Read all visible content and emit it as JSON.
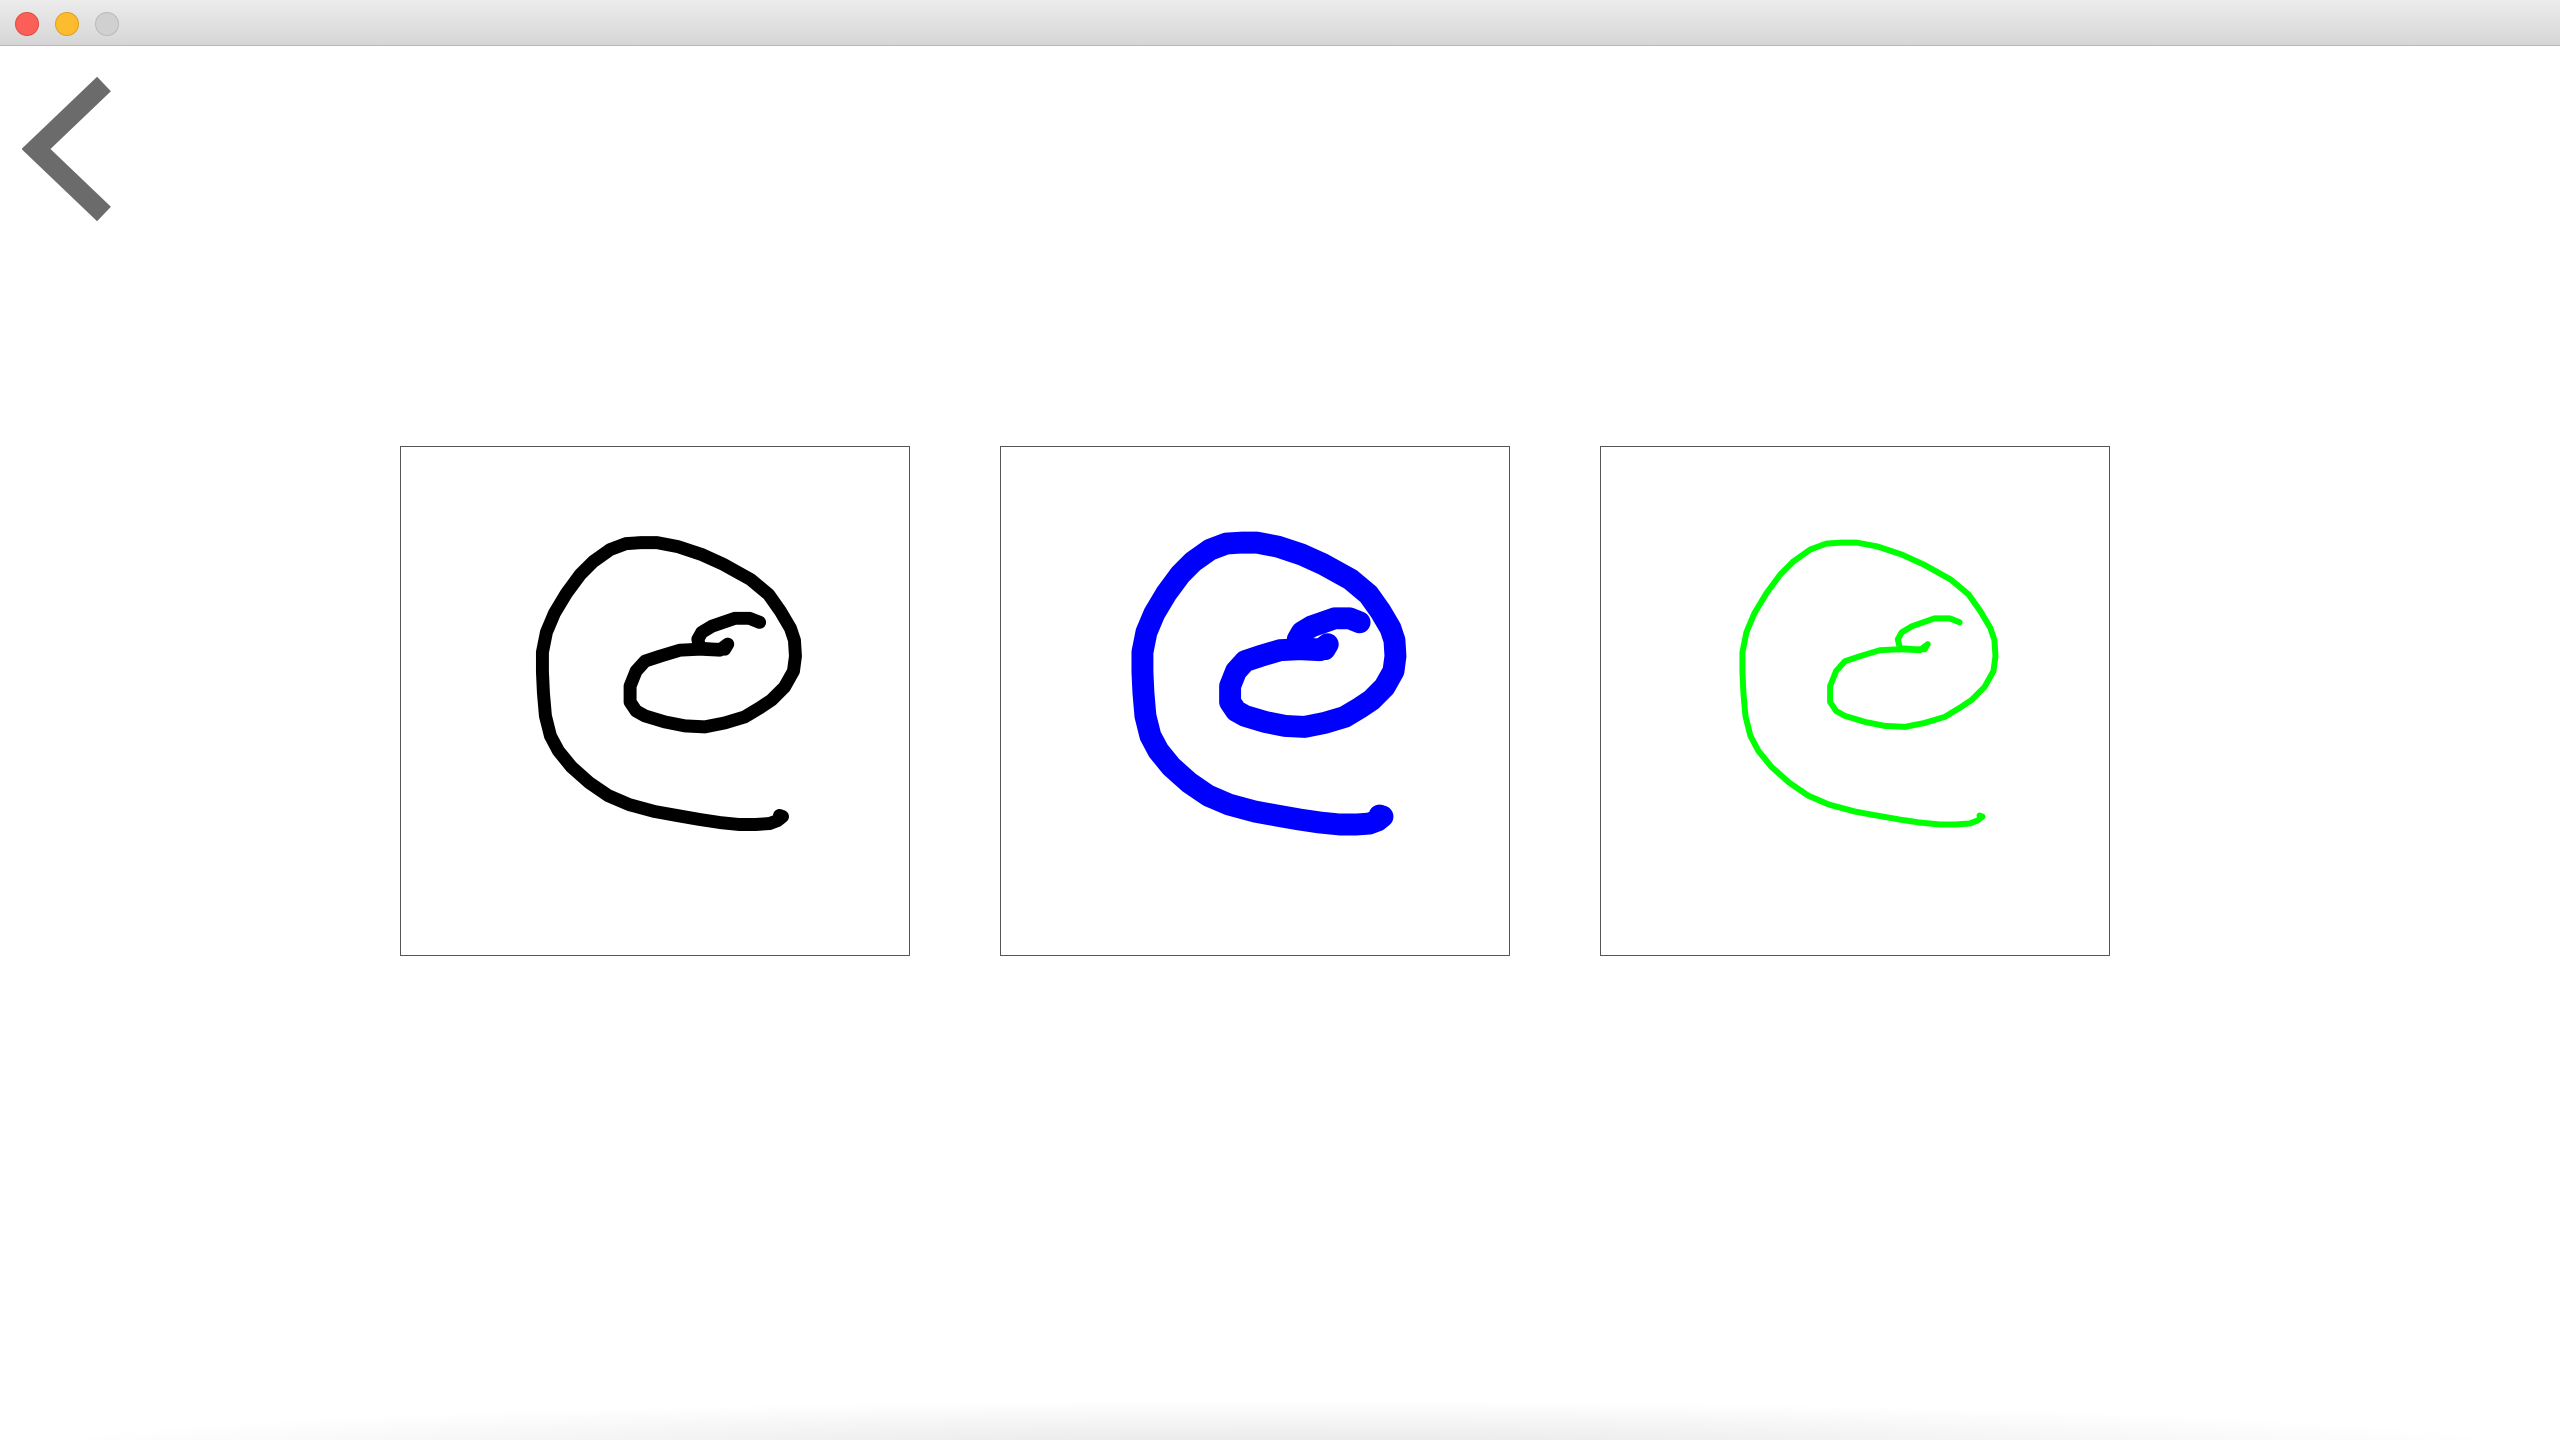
{
  "window": {
    "controls": [
      "close",
      "minimize",
      "zoom"
    ]
  },
  "toolbar": {
    "back_icon": "chevron-left-icon",
    "back_color": "#6b6b6b"
  },
  "canvases": [
    {
      "stroke_color": "#000000",
      "stroke_style": "medium"
    },
    {
      "stroke_color": "#0000ff",
      "stroke_style": "thick"
    },
    {
      "stroke_color": "#00ff00",
      "stroke_style": "thin"
    }
  ]
}
